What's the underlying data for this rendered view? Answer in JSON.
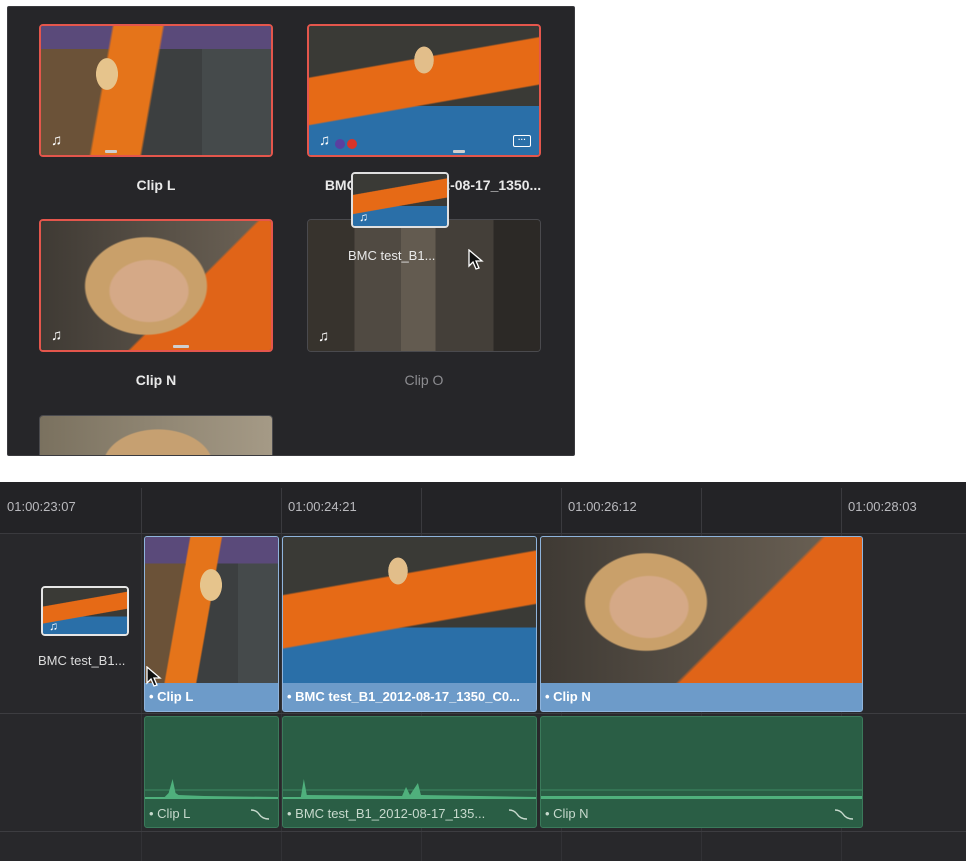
{
  "media_pool": {
    "clips": [
      {
        "name": "Clip L",
        "selected": true,
        "icon": "music-note-icon"
      },
      {
        "name": "BMC test_B1_2012-08-17_1350...",
        "selected": true,
        "icon": "music-note-icon"
      },
      {
        "name": "Clip N",
        "selected": true,
        "icon": "music-note-icon"
      },
      {
        "name": "Clip O",
        "selected": false,
        "icon": "music-note-icon"
      }
    ],
    "drag_overlay_name": "BMC test_B1..."
  },
  "timeline": {
    "ruler": [
      "01:00:23:07",
      "01:00:24:21",
      "01:00:26:12",
      "01:00:28:03"
    ],
    "drop_ghost_name": "BMC test_B1...",
    "video_clips": [
      {
        "label": "• Clip L"
      },
      {
        "label": "• BMC test_B1_2012-08-17_1350_C0..."
      },
      {
        "label": "• Clip N"
      }
    ],
    "audio_clips": [
      {
        "label": "• Clip L"
      },
      {
        "label": "• BMC test_B1_2012-08-17_135..."
      },
      {
        "label": "• Clip N"
      }
    ]
  },
  "colors": {
    "selection_border": "#e4564c",
    "video_clip": "#6d9bc9",
    "audio_clip": "#2a5e45",
    "panel_bg": "#262629"
  }
}
